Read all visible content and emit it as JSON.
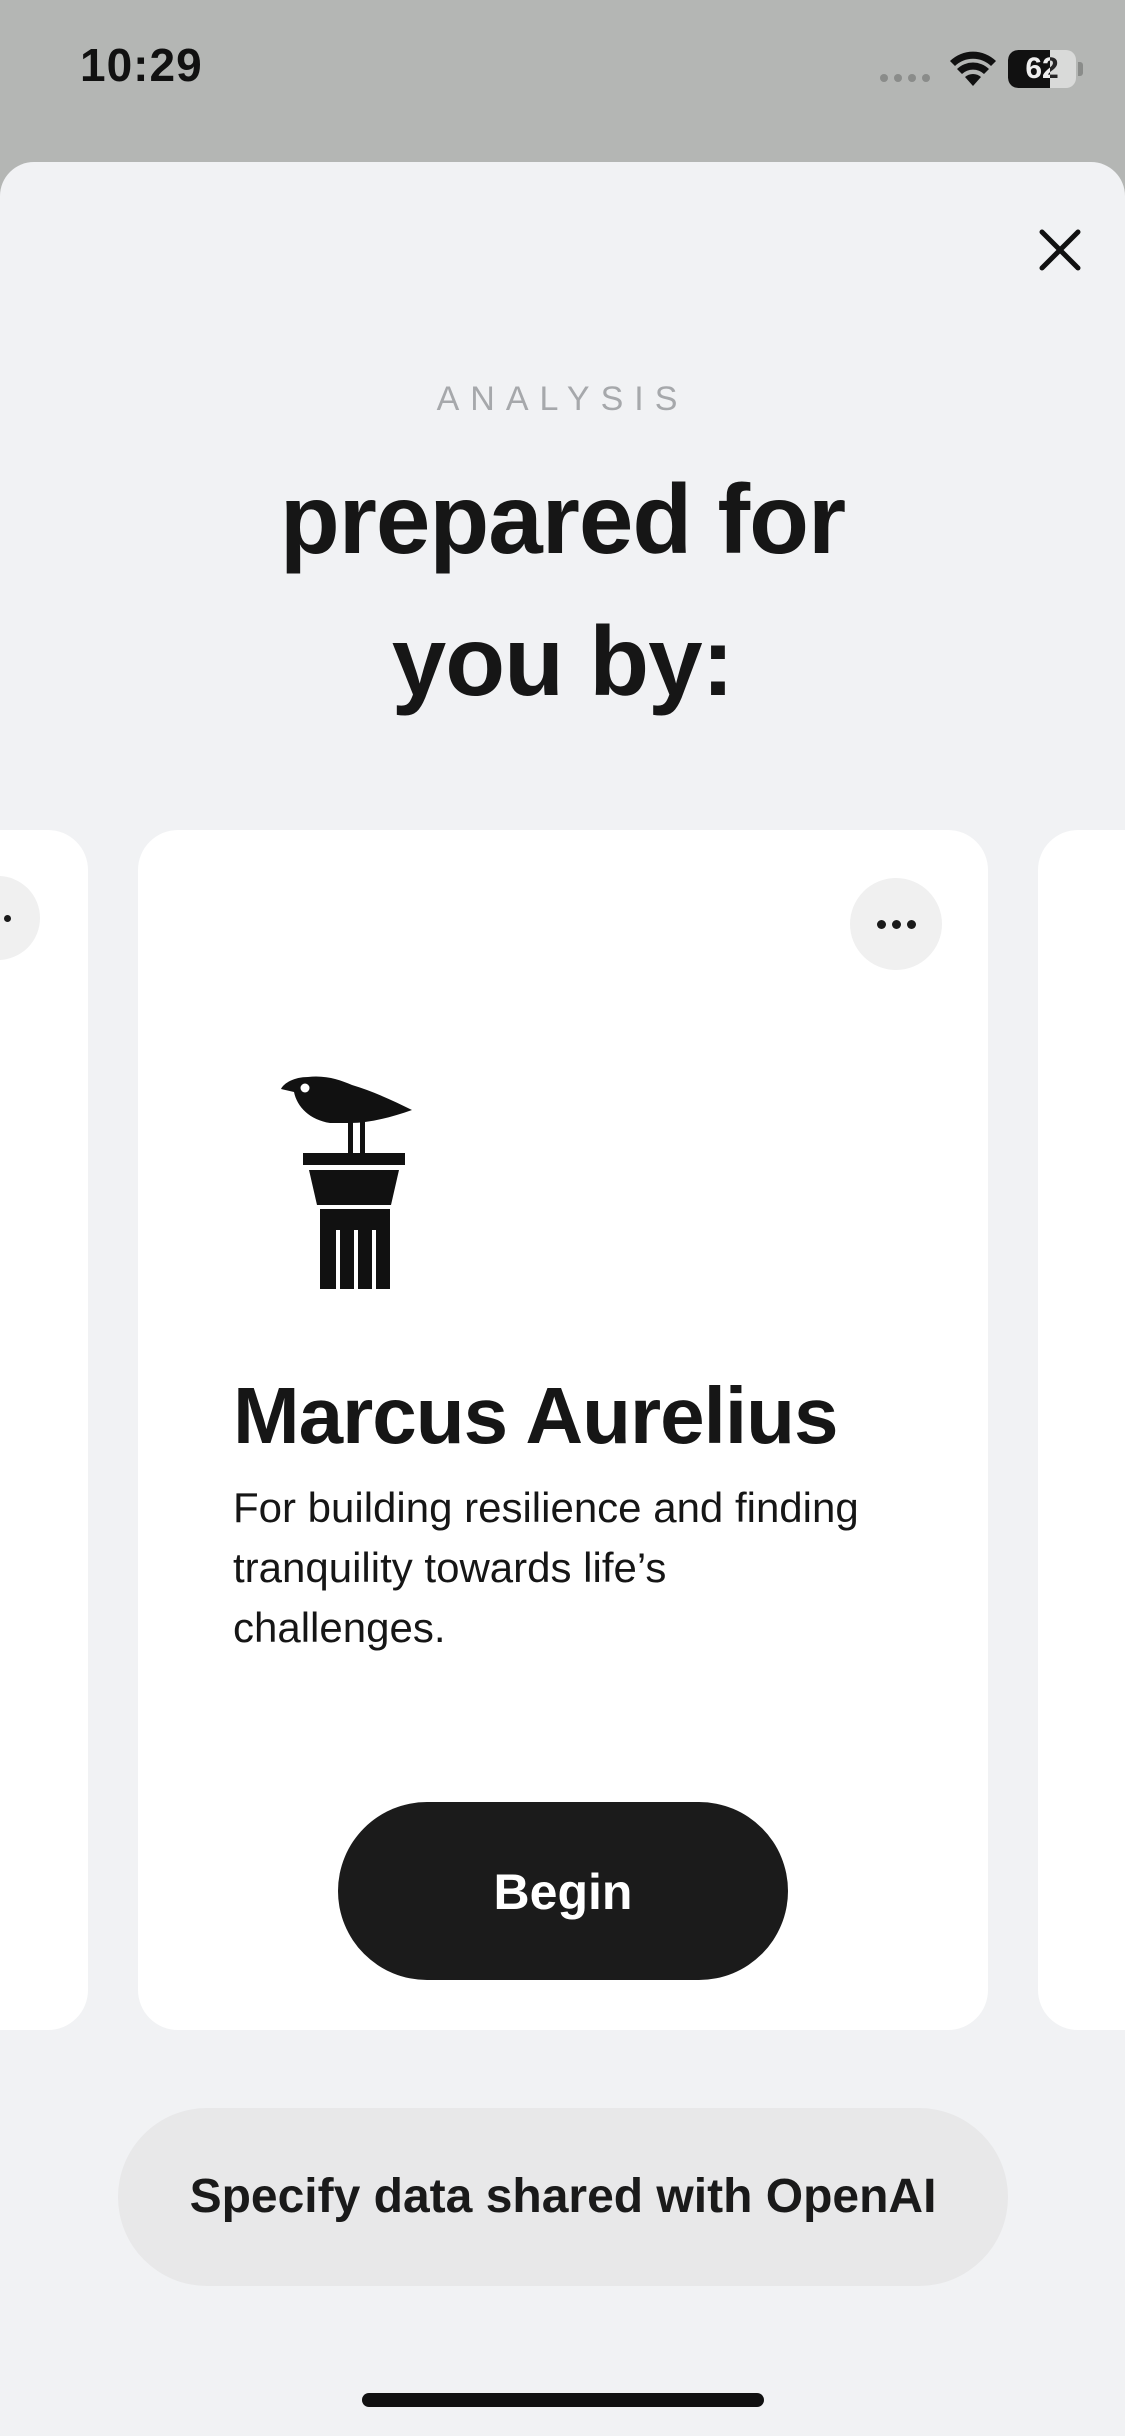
{
  "status_bar": {
    "time": "10:29",
    "battery": "62",
    "battery_level": 0.62
  },
  "sheet": {
    "eyebrow": "ANALYSIS",
    "headline_line1": "prepared for",
    "headline_line2": "you by:"
  },
  "card": {
    "icon": "bird-on-column-icon",
    "name": "Marcus Aurelius",
    "description": "For building resilience and finding tranquility towards life’s challenges.",
    "begin_label": "Begin"
  },
  "footer": {
    "share_label": "Specify data shared with OpenAI"
  }
}
